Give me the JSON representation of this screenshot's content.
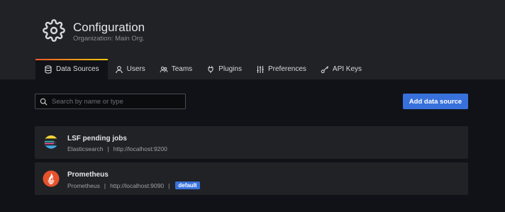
{
  "header": {
    "title": "Configuration",
    "subtitle": "Organization: Main Org.",
    "icon": "gear-icon"
  },
  "tabs": [
    {
      "label": "Data Sources",
      "icon": "database-icon",
      "active": true
    },
    {
      "label": "Users",
      "icon": "user-icon",
      "active": false
    },
    {
      "label": "Teams",
      "icon": "users-icon",
      "active": false
    },
    {
      "label": "Plugins",
      "icon": "plug-icon",
      "active": false
    },
    {
      "label": "Preferences",
      "icon": "sliders-icon",
      "active": false
    },
    {
      "label": "API Keys",
      "icon": "key-icon",
      "active": false
    }
  ],
  "search": {
    "placeholder": "Search by name or type",
    "value": ""
  },
  "add_button_label": "Add data source",
  "datasources": [
    {
      "name": "LSF pending jobs",
      "type": "Elasticsearch",
      "url": "http://localhost:9200",
      "default": false,
      "logo": "elasticsearch-logo"
    },
    {
      "name": "Prometheus",
      "type": "Prometheus",
      "url": "http://localhost:9090",
      "default": true,
      "default_label": "default",
      "logo": "prometheus-logo"
    }
  ],
  "meta_separator": "|",
  "colors": {
    "accent": "#3871dc",
    "page_bg": "#111217",
    "panel_bg": "#202226",
    "tab_gradient_start": "#f05a28",
    "tab_gradient_end": "#fbca0a"
  }
}
